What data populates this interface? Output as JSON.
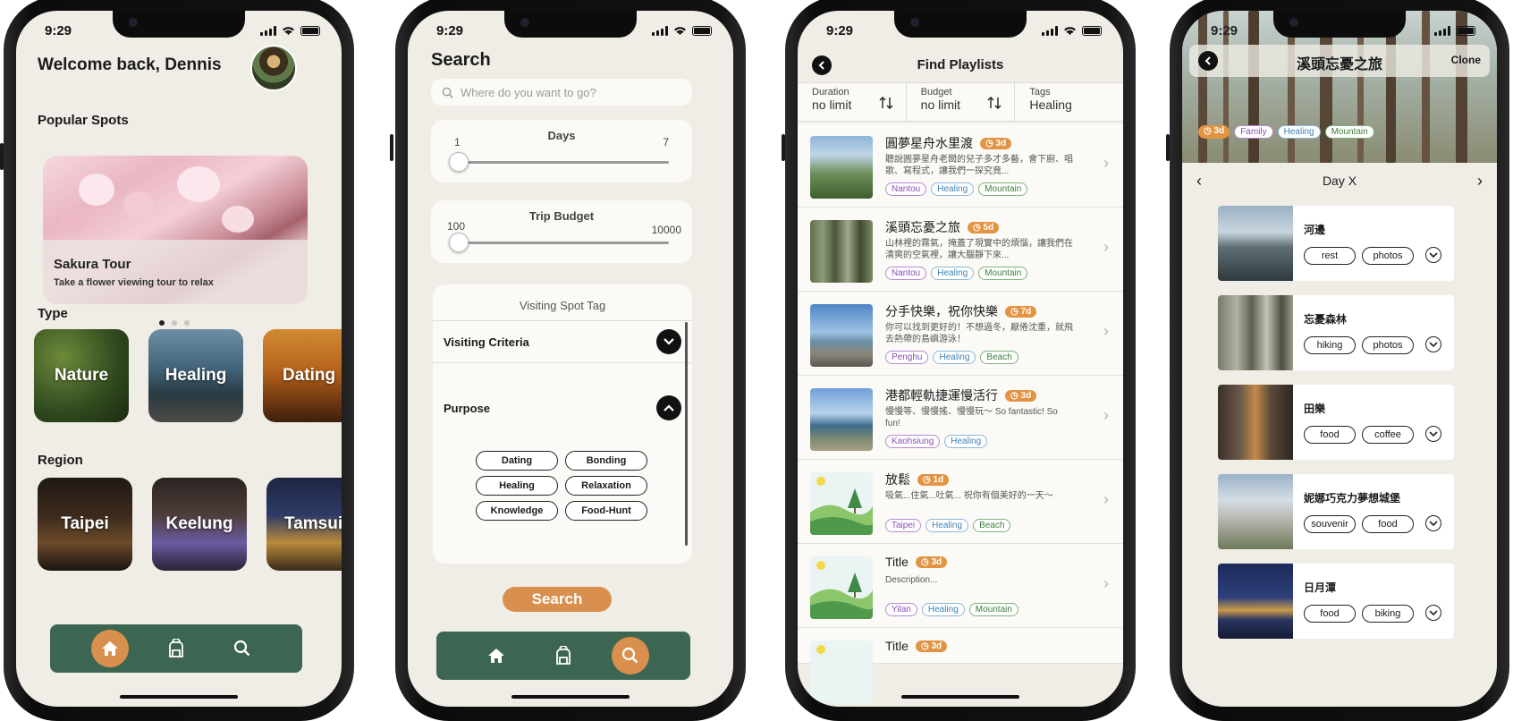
{
  "status_time": "9:29",
  "home": {
    "welcome": "Welcome back, Dennis",
    "popular_title": "Popular Spots",
    "hero_title": "Sakura Tour",
    "hero_sub": "Take a flower viewing tour to relax",
    "carousel_page": 1,
    "carousel_total": 3,
    "type_title": "Type",
    "types": [
      "Nature",
      "Healing",
      "Dating"
    ],
    "region_title": "Region",
    "regions": [
      "Taipei",
      "Keelung",
      "Tamsui"
    ]
  },
  "search": {
    "title": "Search",
    "placeholder": "Where do you want to go?",
    "days_label": "Days",
    "days_min": "1",
    "days_max": "7",
    "days_value": 1,
    "budget_label": "Trip Budget",
    "budget_min": "100",
    "budget_max": "10000",
    "budget_value": 100,
    "tag_card_title": "Visiting Spot Tag",
    "criteria_label": "Visiting Criteria",
    "purpose_label": "Purpose",
    "purpose_pills": [
      "Dating",
      "Bonding",
      "Healing",
      "Relaxation",
      "Knowledge",
      "Food-Hunt"
    ],
    "button": "Search"
  },
  "playlists": {
    "title": "Find Playlists",
    "filters": [
      {
        "key": "Duration",
        "value": "no limit"
      },
      {
        "key": "Budget",
        "value": "no limit"
      },
      {
        "key": "Tags",
        "value": "Healing"
      }
    ],
    "items": [
      {
        "title": "圓夢星舟水里渡",
        "days": "3d",
        "desc": "聽說圓夢星舟老闆的兒子多才多藝，會下廚、唱歌、寫程式，讓我們一探究竟...",
        "tags": [
          "Nantou",
          "Healing",
          "Mountain"
        ]
      },
      {
        "title": "溪頭忘憂之旅",
        "days": "5d",
        "desc": "山林裡的霧氣，掩蓋了現實中的煩惱，讓我們在清爽的空氣裡，讓大腦靜下來...",
        "tags": [
          "Nantou",
          "Healing",
          "Mountain"
        ]
      },
      {
        "title": "分手快樂，祝你快樂",
        "days": "7d",
        "desc": "你可以找到更好的！不想過冬，厭倦沈重，就飛去熱帶的島嶼游泳！",
        "tags": [
          "Penghu",
          "Healing",
          "Beach"
        ]
      },
      {
        "title": "港都輕軌捷運慢活行",
        "days": "3d",
        "desc": "慢慢等、慢慢搖、慢慢玩～ So fantastic! So fun!",
        "tags": [
          "Kaohsiung",
          "Healing"
        ]
      },
      {
        "title": "放鬆",
        "days": "1d",
        "desc": "吸氣...住氣...吐氣... 祝你有個美好的一天～",
        "tags": [
          "Taipei",
          "Healing",
          "Beach"
        ]
      },
      {
        "title": "Title",
        "days": "3d",
        "desc": "Description...",
        "tags": [
          "Yilan",
          "Healing",
          "Mountain"
        ]
      },
      {
        "title": "Title",
        "days": "3d",
        "desc": "",
        "tags": []
      }
    ]
  },
  "detail": {
    "title": "溪頭忘憂之旅",
    "clone": "Clone",
    "tags": [
      "3d",
      "Family",
      "Healing",
      "Mountain"
    ],
    "day_label": "Day X",
    "spots": [
      {
        "name": "河邊",
        "chips": [
          "rest",
          "photos"
        ]
      },
      {
        "name": "忘憂森林",
        "chips": [
          "hiking",
          "photos"
        ]
      },
      {
        "name": "田樂",
        "chips": [
          "food",
          "coffee"
        ]
      },
      {
        "name": "妮娜巧克力夢想城堡",
        "chips": [
          "souvenir",
          "food"
        ]
      },
      {
        "name": "日月潭",
        "chips": [
          "food",
          "biking"
        ]
      }
    ]
  },
  "colors": {
    "accent": "#d98f4e",
    "nav_green": "#3d6652",
    "screen_bg": "#f0ede6",
    "badge_orange": "#e39443"
  }
}
